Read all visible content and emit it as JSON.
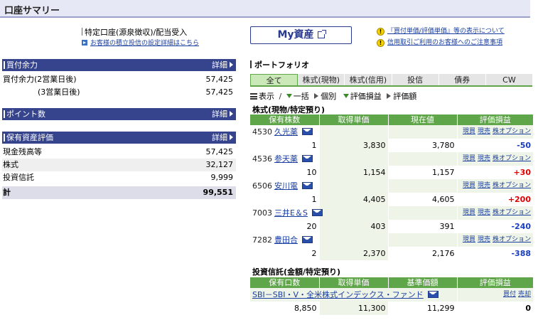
{
  "header": {
    "title": "口座サマリー"
  },
  "account": {
    "type_text": "特定口座(源泉徴収)/配当受入",
    "settings_link": "お客様の積立投信の設定詳細はこちら",
    "my_asset_button": "My資産"
  },
  "notices": [
    {
      "text": "『買付単価/評価単価』等の表示について"
    },
    {
      "text": "信用取引ご利用のお客様へのご注意事項"
    }
  ],
  "sections": {
    "buying_power": {
      "title": "買付余力",
      "more": "詳細",
      "rows": [
        {
          "label": "買付余力(2営業日後)",
          "value": "57,425"
        },
        {
          "label": "(3営業日後)",
          "value": "57,425"
        }
      ]
    },
    "points": {
      "title": "ポイント数",
      "more": "詳細"
    },
    "holdings": {
      "title": "保有資産評価",
      "more": "詳細",
      "rows": [
        {
          "label": "現金残高等",
          "value": "57,425"
        },
        {
          "label": "株式",
          "value": "32,127"
        },
        {
          "label": "投資信託",
          "value": "9,999"
        }
      ],
      "total": {
        "label": "計",
        "value": "99,551"
      }
    }
  },
  "portfolio": {
    "title": "ポートフォリオ",
    "tabs": [
      "全て",
      "株式(現物)",
      "株式(信用)",
      "投信",
      "債券",
      "CW"
    ],
    "filters": {
      "display": "表示",
      "sep": "/",
      "bulk": "一括",
      "individual": "個別",
      "gain": "評価損益",
      "value": "評価額"
    },
    "stocks": {
      "title": "株式(現物/特定預り)",
      "headers": [
        "保有株数",
        "取得単価",
        "現在値",
        "評価損益"
      ],
      "actions": [
        "現買",
        "現売",
        "株オプション"
      ],
      "rows": [
        {
          "code": "4530",
          "name": "久光薬",
          "qty": "1",
          "cost": "3,830",
          "price": "3,780",
          "gain": "-50",
          "sign": "neg"
        },
        {
          "code": "4536",
          "name": "参天薬",
          "qty": "10",
          "cost": "1,154",
          "price": "1,157",
          "gain": "+30",
          "sign": "pos"
        },
        {
          "code": "6506",
          "name": "安川電",
          "qty": "1",
          "cost": "4,405",
          "price": "4,605",
          "gain": "+200",
          "sign": "pos"
        },
        {
          "code": "7003",
          "name": "三井E＆S",
          "qty": "20",
          "cost": "403",
          "price": "391",
          "gain": "-240",
          "sign": "neg"
        },
        {
          "code": "7282",
          "name": "豊田合",
          "qty": "2",
          "cost": "2,370",
          "price": "2,176",
          "gain": "-388",
          "sign": "neg"
        }
      ]
    },
    "funds": {
      "title": "投資信託(金額/特定預り)",
      "headers": [
        "保有口数",
        "取得単価",
        "基準価額",
        "評価損益"
      ],
      "actions": [
        "買付",
        "売却"
      ],
      "rows": [
        {
          "name": "SBI－SBI・V・全米株式インデックス・ファンド",
          "qty": "8,850",
          "cost": "11,300",
          "price": "11,299",
          "gain": "0",
          "sign": "zero"
        }
      ]
    }
  },
  "colors": {
    "nav_blue": "#36448e",
    "table_green": "#5fa54a",
    "gain_positive": "#e00000",
    "gain_negative": "#1a3ec0"
  }
}
